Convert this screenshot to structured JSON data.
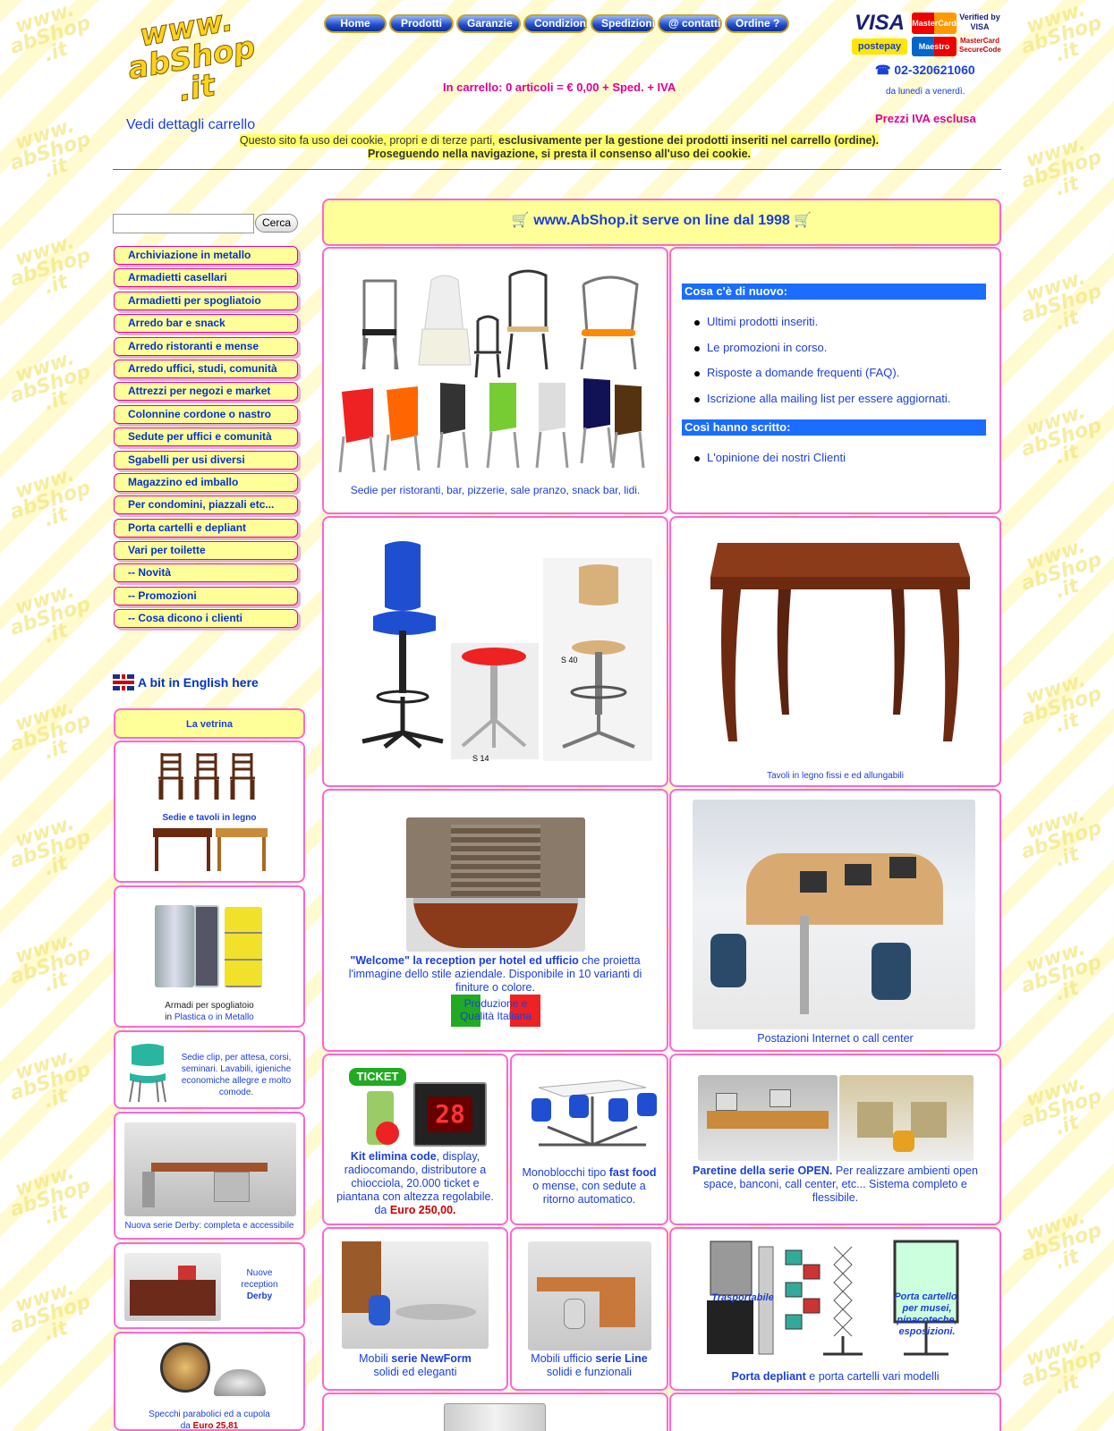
{
  "header": {
    "logo_lines": [
      "www.",
      "abShop",
      ".it"
    ],
    "cart_link": "Vedi dettagli carrello",
    "nav": [
      "Home",
      "Prodotti",
      "Garanzie",
      "Condizioni",
      "Spedizioni",
      "@ contatti",
      "Ordine ?"
    ],
    "cart_summary": "In carrello: 0 articoli = € 0,00 + Sped. + IVA",
    "phone": "02-320621060",
    "hours": "da lunedì a venerdì.",
    "prices_note": "Prezzi IVA esclusa",
    "cookie_a": "Questo sito fa uso dei cookie, propri e di terze parti, ",
    "cookie_b": "esclusivamente per la gestione dei prodotti inseriti nel carrello (ordine).",
    "cookie_c": "Proseguendo nella navigazione, si presta il consenso all'uso dei cookie.",
    "cards": [
      "VISA",
      "postepay",
      "MasterCard",
      "Maestro",
      "Verified by VISA",
      "MasterCard SecureCode"
    ]
  },
  "sidebar": {
    "search_button": "Cerca",
    "menu": [
      "Archiviazione in metallo",
      "Armadietti casellari",
      "Armadietti per spogliatoio",
      "Arredo bar e snack",
      "Arredo ristoranti e mense",
      "Arredo uffici, studi, comunità",
      "Attrezzi per negozi e market",
      "Colonnine cordone o nastro",
      "Sedute per uffici e comunità",
      "Sgabelli per usi diversi",
      "Magazzino ed imballo",
      "Per condomini, piazzali etc...",
      "Porta cartelli e depliant",
      "Vari per toilette",
      "-- Novità",
      "-- Promozioni",
      "-- Cosa dicono i clienti"
    ],
    "english": "A bit in English here",
    "vetrina": "La vetrina",
    "v1": "Sedie e tavoli  in legno",
    "v2a": "Armadi per spogliatoio",
    "v2b": "in ",
    "v2c": "Plastica o in Metallo",
    "v3": "Sedie clip, per attesa, corsi, seminari. Lavabili, igieniche economiche allegre e molto comode.",
    "v4": "Nuova serie Derby: completa e accessibile",
    "v5a": "Nuove reception",
    "v5b": "Derby",
    "v6a": "Specchi parabolici ed a cupola",
    "v6b": "da ",
    "v6c": "Euro 25,81"
  },
  "main": {
    "banner": "www.AbShop.it  serve on line dal 1998",
    "chairs_caption": "Sedie per ristoranti, bar, pizzerie, sale pranzo, snack bar, lidi.",
    "news_title": "Cosa c'è di nuovo:",
    "news": [
      "Ultimi prodotti inseriti.",
      "Le promozioni in corso.",
      "Risposte a domande frequenti (FAQ).",
      "Iscrizione alla mailing list per essere aggiornati."
    ],
    "wrote_title": "Così hanno scritto:",
    "wrote": [
      "L'opinione dei nostri Clienti"
    ],
    "stool_labels": [
      "S 40",
      "S 14"
    ],
    "table_caption": "Tavoli in legno fissi e ed allungabili",
    "welcome_bold": "\"Welcome\" la reception per hotel ed ufficio",
    "welcome_text": " che proietta l'immagine dello stile aziendale. Disponibile in 10 varianti di finiture o colore.",
    "made_in": "Produzione e Qualità Italiana",
    "callcenter": "Postazioni Internet o call center",
    "ticket_sign": "TICKET",
    "ticket_display": "28",
    "ticket_bold": "Kit elimina code",
    "ticket_text": ", display, radiocomando, distributore a chiocciola,  20.000 ticket e piantana con altezza regolabile.",
    "ticket_price_pre": "da ",
    "ticket_price": "Euro 250,00.",
    "fastfood_pre": "Monoblocchi tipo ",
    "fastfood_bold": "fast food",
    "fastfood_post": " o mense, con sedute a ritorno automatico.",
    "open_bold": "Paretine della serie OPEN.",
    "open_text": " Per realizzare ambienti open space, banconi, call center, etc... Sistema completo e flessibile.",
    "newform_pre": "Mobili ",
    "newform_bold": "serie NewForm",
    "newform_line2": "solidi ed eleganti",
    "line_pre": "Mobili ufficio ",
    "line_bold": "serie Line",
    "line_line2": "solidi e funzionali",
    "dep_label1": "Trasportabile",
    "dep_label2": "Porta cartello, per musei, pinacoteche, esposizioni.",
    "dep_bold": "Porta depliant",
    "dep_text": " e porta cartelli vari modelli"
  }
}
